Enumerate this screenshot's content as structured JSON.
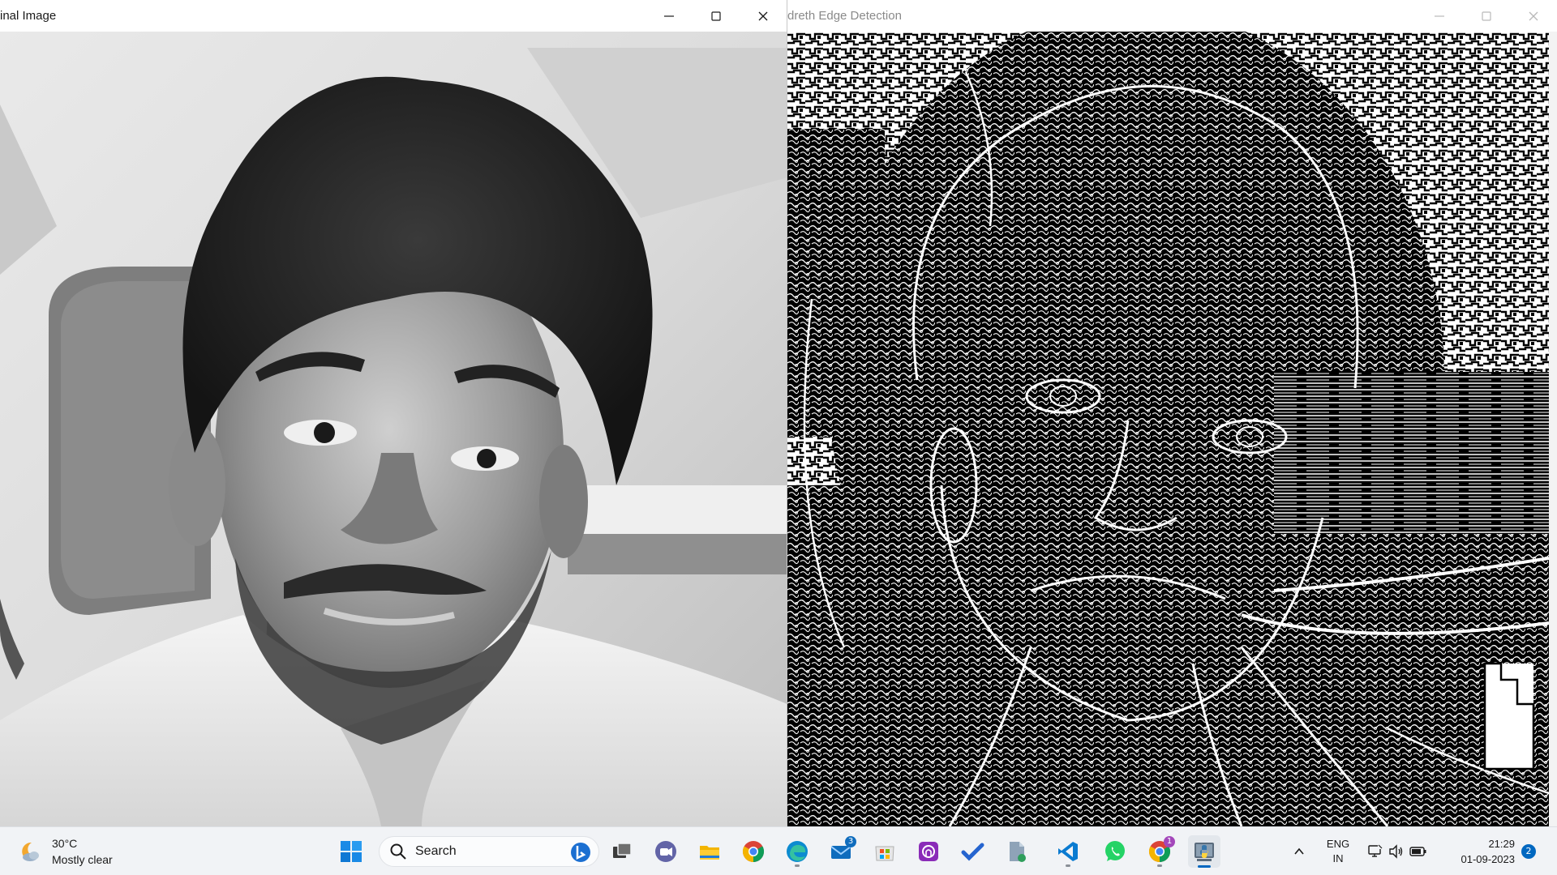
{
  "left_window": {
    "title": "inal Image",
    "image_description_icon": "grayscale-portrait-photo"
  },
  "right_window": {
    "title": "dreth Edge Detection",
    "image_description_icon": "edge-detection-output"
  },
  "taskbar": {
    "weather": {
      "temp": "30°C",
      "condition": "Mostly clear",
      "icon": "moon-cloud-icon"
    },
    "search": {
      "label": "Search"
    },
    "apps": [
      {
        "name": "start",
        "icon": "windows-icon"
      },
      {
        "name": "task-view",
        "icon": "task-view-icon"
      },
      {
        "name": "teams-chat",
        "icon": "video-chat-icon"
      },
      {
        "name": "file-explorer",
        "icon": "folder-icon"
      },
      {
        "name": "chrome",
        "icon": "chrome-icon"
      },
      {
        "name": "edge",
        "icon": "edge-icon"
      },
      {
        "name": "mail",
        "icon": "mail-icon",
        "badge": "3"
      },
      {
        "name": "store",
        "icon": "store-icon"
      },
      {
        "name": "app-purple",
        "icon": "purple-app-icon"
      },
      {
        "name": "todo",
        "icon": "checkmark-icon"
      },
      {
        "name": "file-app",
        "icon": "document-icon"
      },
      {
        "name": "vscode",
        "icon": "vscode-icon"
      },
      {
        "name": "whatsapp",
        "icon": "whatsapp-icon"
      },
      {
        "name": "chrome-profile",
        "icon": "chrome-profile-icon",
        "badge": "1"
      },
      {
        "name": "python",
        "icon": "python-icon"
      }
    ],
    "tray": {
      "lang_line1": "ENG",
      "lang_line2": "IN",
      "time": "21:29",
      "date": "01-09-2023",
      "notifications": "2"
    }
  },
  "colors": {
    "taskbar_bg": "#f1f3f6",
    "accent": "#0067c0",
    "mail_badge": "#0f6cbd",
    "chrome_badge": "#a347ba"
  }
}
